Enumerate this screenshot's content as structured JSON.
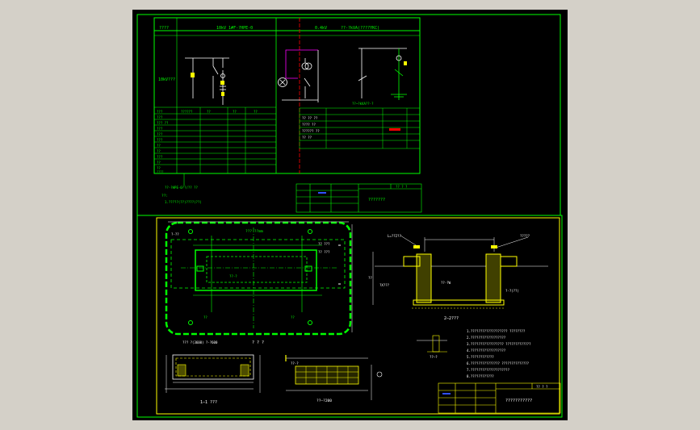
{
  "colors": {
    "background": "#000000",
    "frame_green": "#00ff00",
    "frame_yellow": "#ffff00",
    "white": "#ffffff",
    "red": "#ff0000",
    "blue": "#3050ff",
    "magenta": "#ff00ff",
    "cyan": "#00ffff"
  },
  "sheet1": {
    "header": {
      "left": "????",
      "middle": "10kV 1#F-?HPE-0",
      "right_a": "0.4kV",
      "right_b": "??-?kVA(????YKC)"
    },
    "side_label": "10kV???",
    "table_left_rows": [
      "???",
      "???",
      "??? ??",
      "???",
      "???",
      "???",
      "??",
      "??",
      "???",
      "??",
      "??",
      "????",
      "??????"
    ],
    "table_left_cols": [
      "??",
      "??",
      "??"
    ],
    "table_right_rows": [
      "?? ?? ??",
      "???? ??",
      "?????? ??",
      "?? ??"
    ],
    "note_title": "??:",
    "note_1": "1.?????(??)????(??)",
    "callout_left": "??-?HPE-0??/?? ??",
    "callout_right": "??~?kVA??-?",
    "title_block": {
      "drawing_title": "???????",
      "sheet_no": "?? ? ?"
    }
  },
  "sheet2": {
    "plan": {
      "top_dim": "???  ??mm",
      "right_label_1": "?? ???",
      "right_label_2": "?? ???",
      "left_dim": "?-??",
      "inner_label": "??-?",
      "bottom_dim_a": "??",
      "bottom_dim_b": "??",
      "bottom_label": "???  ?(3600) ?-?600",
      "bottom_tag": "? ? ?"
    },
    "section_a": {
      "title": "2—2???",
      "left_dim": "??",
      "label_left": "?X???",
      "label_mid": "??-?W",
      "label_top_left": "L=??2??",
      "label_top_right": "?????",
      "label_right": "?-?(??)"
    },
    "section_b": {
      "title": "1—1 ???"
    },
    "section_c": {
      "title": "??—?200",
      "label": "??-?"
    },
    "detail": {
      "title": "??—?"
    },
    "notes": [
      "1.???????????????????   ????????",
      "2.??????????????????",
      "3.?????????????????   ?????????????",
      "4.??????????????????",
      "5.????????????",
      "6.???????????????   ??????????????",
      "7.????????????????????",
      "8.????????????"
    ],
    "title_block": {
      "drawing_title": "???????????",
      "sheet_no": "?? ? ?"
    }
  }
}
